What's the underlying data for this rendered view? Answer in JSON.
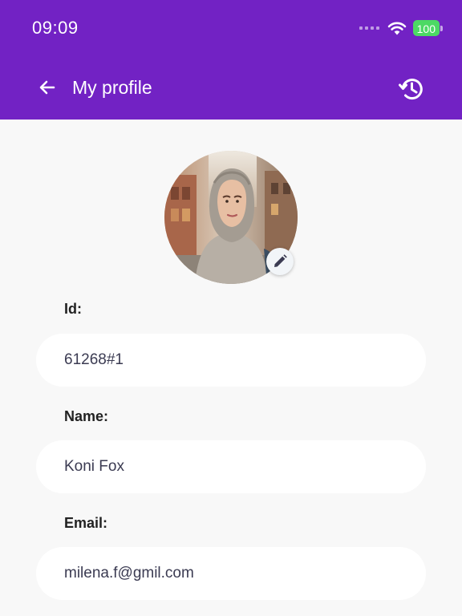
{
  "status_bar": {
    "time": "09:09",
    "battery": "100"
  },
  "header": {
    "title": "My profile",
    "back_icon": "arrow-left-icon",
    "history_icon": "history-icon",
    "color": "#7222c4"
  },
  "profile": {
    "avatar_icon": "profile-photo",
    "edit_icon": "pencil-icon"
  },
  "fields": {
    "id": {
      "label": "Id:",
      "value": "61268#1"
    },
    "name": {
      "label": "Name:",
      "value": "Koni Fox"
    },
    "email": {
      "label": "Email:",
      "value": "milena.f@gmil.com"
    }
  }
}
